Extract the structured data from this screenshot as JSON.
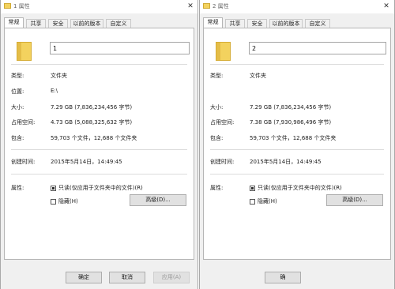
{
  "windows": [
    {
      "title": "1 属性",
      "tabs": [
        "常规",
        "共享",
        "安全",
        "以前的版本",
        "自定义"
      ],
      "name_value": "1",
      "fields": [
        {
          "label": "类型:",
          "value": "文件夹"
        },
        {
          "label": "位置:",
          "value": "E:\\"
        },
        {
          "label": "大小:",
          "value": "7.29 GB (7,836,234,456 字节)"
        },
        {
          "label": "占用空间:",
          "value": "4.73 GB (5,088,325,632 字节)"
        },
        {
          "label": "包含:",
          "value": "59,703 个文件，12,688 个文件夹"
        },
        {
          "label": "创建时间:",
          "value": "2015年5月14日，14:49:45"
        }
      ],
      "attributes_label": "属性:",
      "readonly_label": "只读(仅应用于文件夹中的文件)(R)",
      "readonly_checked": true,
      "hidden_label": "隐藏(H)",
      "hidden_checked": false,
      "advanced_label": "高级(D)...",
      "buttons": [
        "确定",
        "取消",
        "应用(A)"
      ]
    },
    {
      "title": "2 属性",
      "tabs": [
        "常规",
        "共享",
        "安全",
        "以前的版本",
        "自定义"
      ],
      "name_value": "2",
      "fields": [
        {
          "label": "类型:",
          "value": "文件夹"
        },
        {
          "label": "大小:",
          "value": "7.29 GB (7,836,234,456 字节)"
        },
        {
          "label": "占用空间:",
          "value": "7.38 GB (7,930,986,496 字节)"
        },
        {
          "label": "包含:",
          "value": "59,703 个文件，12,688 个文件夹"
        },
        {
          "label": "创建时间:",
          "value": "2015年5月14日，14:49:45"
        }
      ],
      "attributes_label": "属性:",
      "readonly_label": "只读(仅应用于文件夹中的文件)(R)",
      "readonly_checked": true,
      "hidden_label": "隐藏(H)",
      "hidden_checked": false,
      "advanced_label": "高级(D)...",
      "buttons": [
        "确"
      ]
    }
  ]
}
